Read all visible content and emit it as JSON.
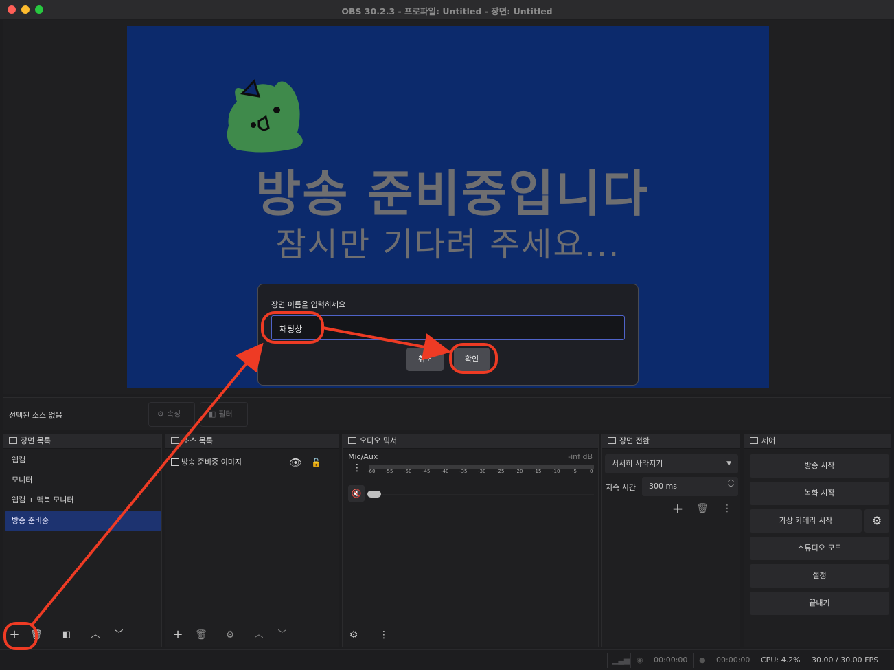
{
  "window": {
    "title": "OBS 30.2.3 - 프로파일: Untitled - 장면: Untitled"
  },
  "preview": {
    "headline": "방송 준비중입니다",
    "subline": "잠시만 기다려 주세요..."
  },
  "dialog": {
    "prompt": "장면 이름을 입력하세요",
    "input_value": "채팅창",
    "cancel_label": "취소",
    "ok_label": "확인"
  },
  "properties_bar": {
    "no_source_text": "선택된 소스 없음",
    "properties_label": "속성",
    "filters_label": "필터"
  },
  "scenes": {
    "title": "장면 목록",
    "items": [
      {
        "label": "웹캠",
        "selected": false
      },
      {
        "label": "모니터",
        "selected": false
      },
      {
        "label": "웹캠 + 맥북 모니터",
        "selected": false
      },
      {
        "label": "방송 준비중",
        "selected": true
      }
    ]
  },
  "sources": {
    "title": "소스 목록",
    "items": [
      {
        "label": "방송 준비중 이미지",
        "icon": "image-icon",
        "visible": true,
        "locked": false
      }
    ]
  },
  "mixer": {
    "title": "오디오 믹서",
    "channel": "Mic/Aux",
    "level": "-inf dB",
    "ticks": [
      "-60",
      "-55",
      "-50",
      "-45",
      "-40",
      "-35",
      "-30",
      "-25",
      "-20",
      "-15",
      "-10",
      "-5",
      "0"
    ],
    "muted": true,
    "volume": 0
  },
  "transitions": {
    "title": "장면 전환",
    "selected": "서서히 사라지기",
    "duration_label": "지속 시간",
    "duration_value": "300 ms"
  },
  "controls": {
    "title": "제어",
    "start_streaming": "방송 시작",
    "start_recording": "녹화 시작",
    "start_virtual_camera": "가상 카메라 시작",
    "studio_mode": "스튜디오 모드",
    "settings": "설정",
    "exit": "끝내기"
  },
  "status": {
    "stream_time": "00:00:00",
    "record_time": "00:00:00",
    "cpu": "CPU: 4.2%",
    "fps": "30.00 / 30.00 FPS"
  },
  "colors": {
    "accent": "#1d3370",
    "annotation": "#ee3b24",
    "preview_bg": "#0c2a6c",
    "mascot": "#3f8a4b"
  }
}
